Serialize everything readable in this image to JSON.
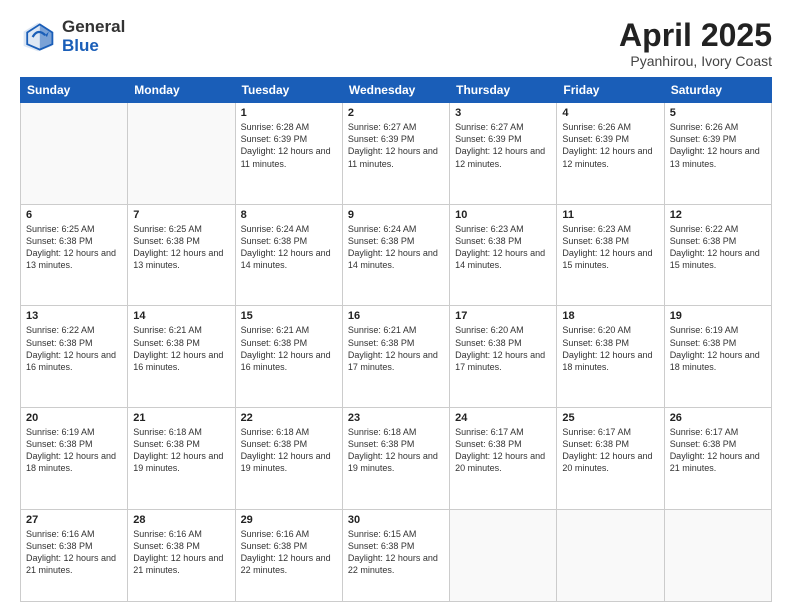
{
  "logo": {
    "general": "General",
    "blue": "Blue"
  },
  "title": "April 2025",
  "subtitle": "Pyanhirou, Ivory Coast",
  "days_of_week": [
    "Sunday",
    "Monday",
    "Tuesday",
    "Wednesday",
    "Thursday",
    "Friday",
    "Saturday"
  ],
  "weeks": [
    [
      {
        "day": "",
        "info": ""
      },
      {
        "day": "",
        "info": ""
      },
      {
        "day": "1",
        "info": "Sunrise: 6:28 AM\nSunset: 6:39 PM\nDaylight: 12 hours and 11 minutes."
      },
      {
        "day": "2",
        "info": "Sunrise: 6:27 AM\nSunset: 6:39 PM\nDaylight: 12 hours and 11 minutes."
      },
      {
        "day": "3",
        "info": "Sunrise: 6:27 AM\nSunset: 6:39 PM\nDaylight: 12 hours and 12 minutes."
      },
      {
        "day": "4",
        "info": "Sunrise: 6:26 AM\nSunset: 6:39 PM\nDaylight: 12 hours and 12 minutes."
      },
      {
        "day": "5",
        "info": "Sunrise: 6:26 AM\nSunset: 6:39 PM\nDaylight: 12 hours and 13 minutes."
      }
    ],
    [
      {
        "day": "6",
        "info": "Sunrise: 6:25 AM\nSunset: 6:38 PM\nDaylight: 12 hours and 13 minutes."
      },
      {
        "day": "7",
        "info": "Sunrise: 6:25 AM\nSunset: 6:38 PM\nDaylight: 12 hours and 13 minutes."
      },
      {
        "day": "8",
        "info": "Sunrise: 6:24 AM\nSunset: 6:38 PM\nDaylight: 12 hours and 14 minutes."
      },
      {
        "day": "9",
        "info": "Sunrise: 6:24 AM\nSunset: 6:38 PM\nDaylight: 12 hours and 14 minutes."
      },
      {
        "day": "10",
        "info": "Sunrise: 6:23 AM\nSunset: 6:38 PM\nDaylight: 12 hours and 14 minutes."
      },
      {
        "day": "11",
        "info": "Sunrise: 6:23 AM\nSunset: 6:38 PM\nDaylight: 12 hours and 15 minutes."
      },
      {
        "day": "12",
        "info": "Sunrise: 6:22 AM\nSunset: 6:38 PM\nDaylight: 12 hours and 15 minutes."
      }
    ],
    [
      {
        "day": "13",
        "info": "Sunrise: 6:22 AM\nSunset: 6:38 PM\nDaylight: 12 hours and 16 minutes."
      },
      {
        "day": "14",
        "info": "Sunrise: 6:21 AM\nSunset: 6:38 PM\nDaylight: 12 hours and 16 minutes."
      },
      {
        "day": "15",
        "info": "Sunrise: 6:21 AM\nSunset: 6:38 PM\nDaylight: 12 hours and 16 minutes."
      },
      {
        "day": "16",
        "info": "Sunrise: 6:21 AM\nSunset: 6:38 PM\nDaylight: 12 hours and 17 minutes."
      },
      {
        "day": "17",
        "info": "Sunrise: 6:20 AM\nSunset: 6:38 PM\nDaylight: 12 hours and 17 minutes."
      },
      {
        "day": "18",
        "info": "Sunrise: 6:20 AM\nSunset: 6:38 PM\nDaylight: 12 hours and 18 minutes."
      },
      {
        "day": "19",
        "info": "Sunrise: 6:19 AM\nSunset: 6:38 PM\nDaylight: 12 hours and 18 minutes."
      }
    ],
    [
      {
        "day": "20",
        "info": "Sunrise: 6:19 AM\nSunset: 6:38 PM\nDaylight: 12 hours and 18 minutes."
      },
      {
        "day": "21",
        "info": "Sunrise: 6:18 AM\nSunset: 6:38 PM\nDaylight: 12 hours and 19 minutes."
      },
      {
        "day": "22",
        "info": "Sunrise: 6:18 AM\nSunset: 6:38 PM\nDaylight: 12 hours and 19 minutes."
      },
      {
        "day": "23",
        "info": "Sunrise: 6:18 AM\nSunset: 6:38 PM\nDaylight: 12 hours and 19 minutes."
      },
      {
        "day": "24",
        "info": "Sunrise: 6:17 AM\nSunset: 6:38 PM\nDaylight: 12 hours and 20 minutes."
      },
      {
        "day": "25",
        "info": "Sunrise: 6:17 AM\nSunset: 6:38 PM\nDaylight: 12 hours and 20 minutes."
      },
      {
        "day": "26",
        "info": "Sunrise: 6:17 AM\nSunset: 6:38 PM\nDaylight: 12 hours and 21 minutes."
      }
    ],
    [
      {
        "day": "27",
        "info": "Sunrise: 6:16 AM\nSunset: 6:38 PM\nDaylight: 12 hours and 21 minutes."
      },
      {
        "day": "28",
        "info": "Sunrise: 6:16 AM\nSunset: 6:38 PM\nDaylight: 12 hours and 21 minutes."
      },
      {
        "day": "29",
        "info": "Sunrise: 6:16 AM\nSunset: 6:38 PM\nDaylight: 12 hours and 22 minutes."
      },
      {
        "day": "30",
        "info": "Sunrise: 6:15 AM\nSunset: 6:38 PM\nDaylight: 12 hours and 22 minutes."
      },
      {
        "day": "",
        "info": ""
      },
      {
        "day": "",
        "info": ""
      },
      {
        "day": "",
        "info": ""
      }
    ]
  ]
}
